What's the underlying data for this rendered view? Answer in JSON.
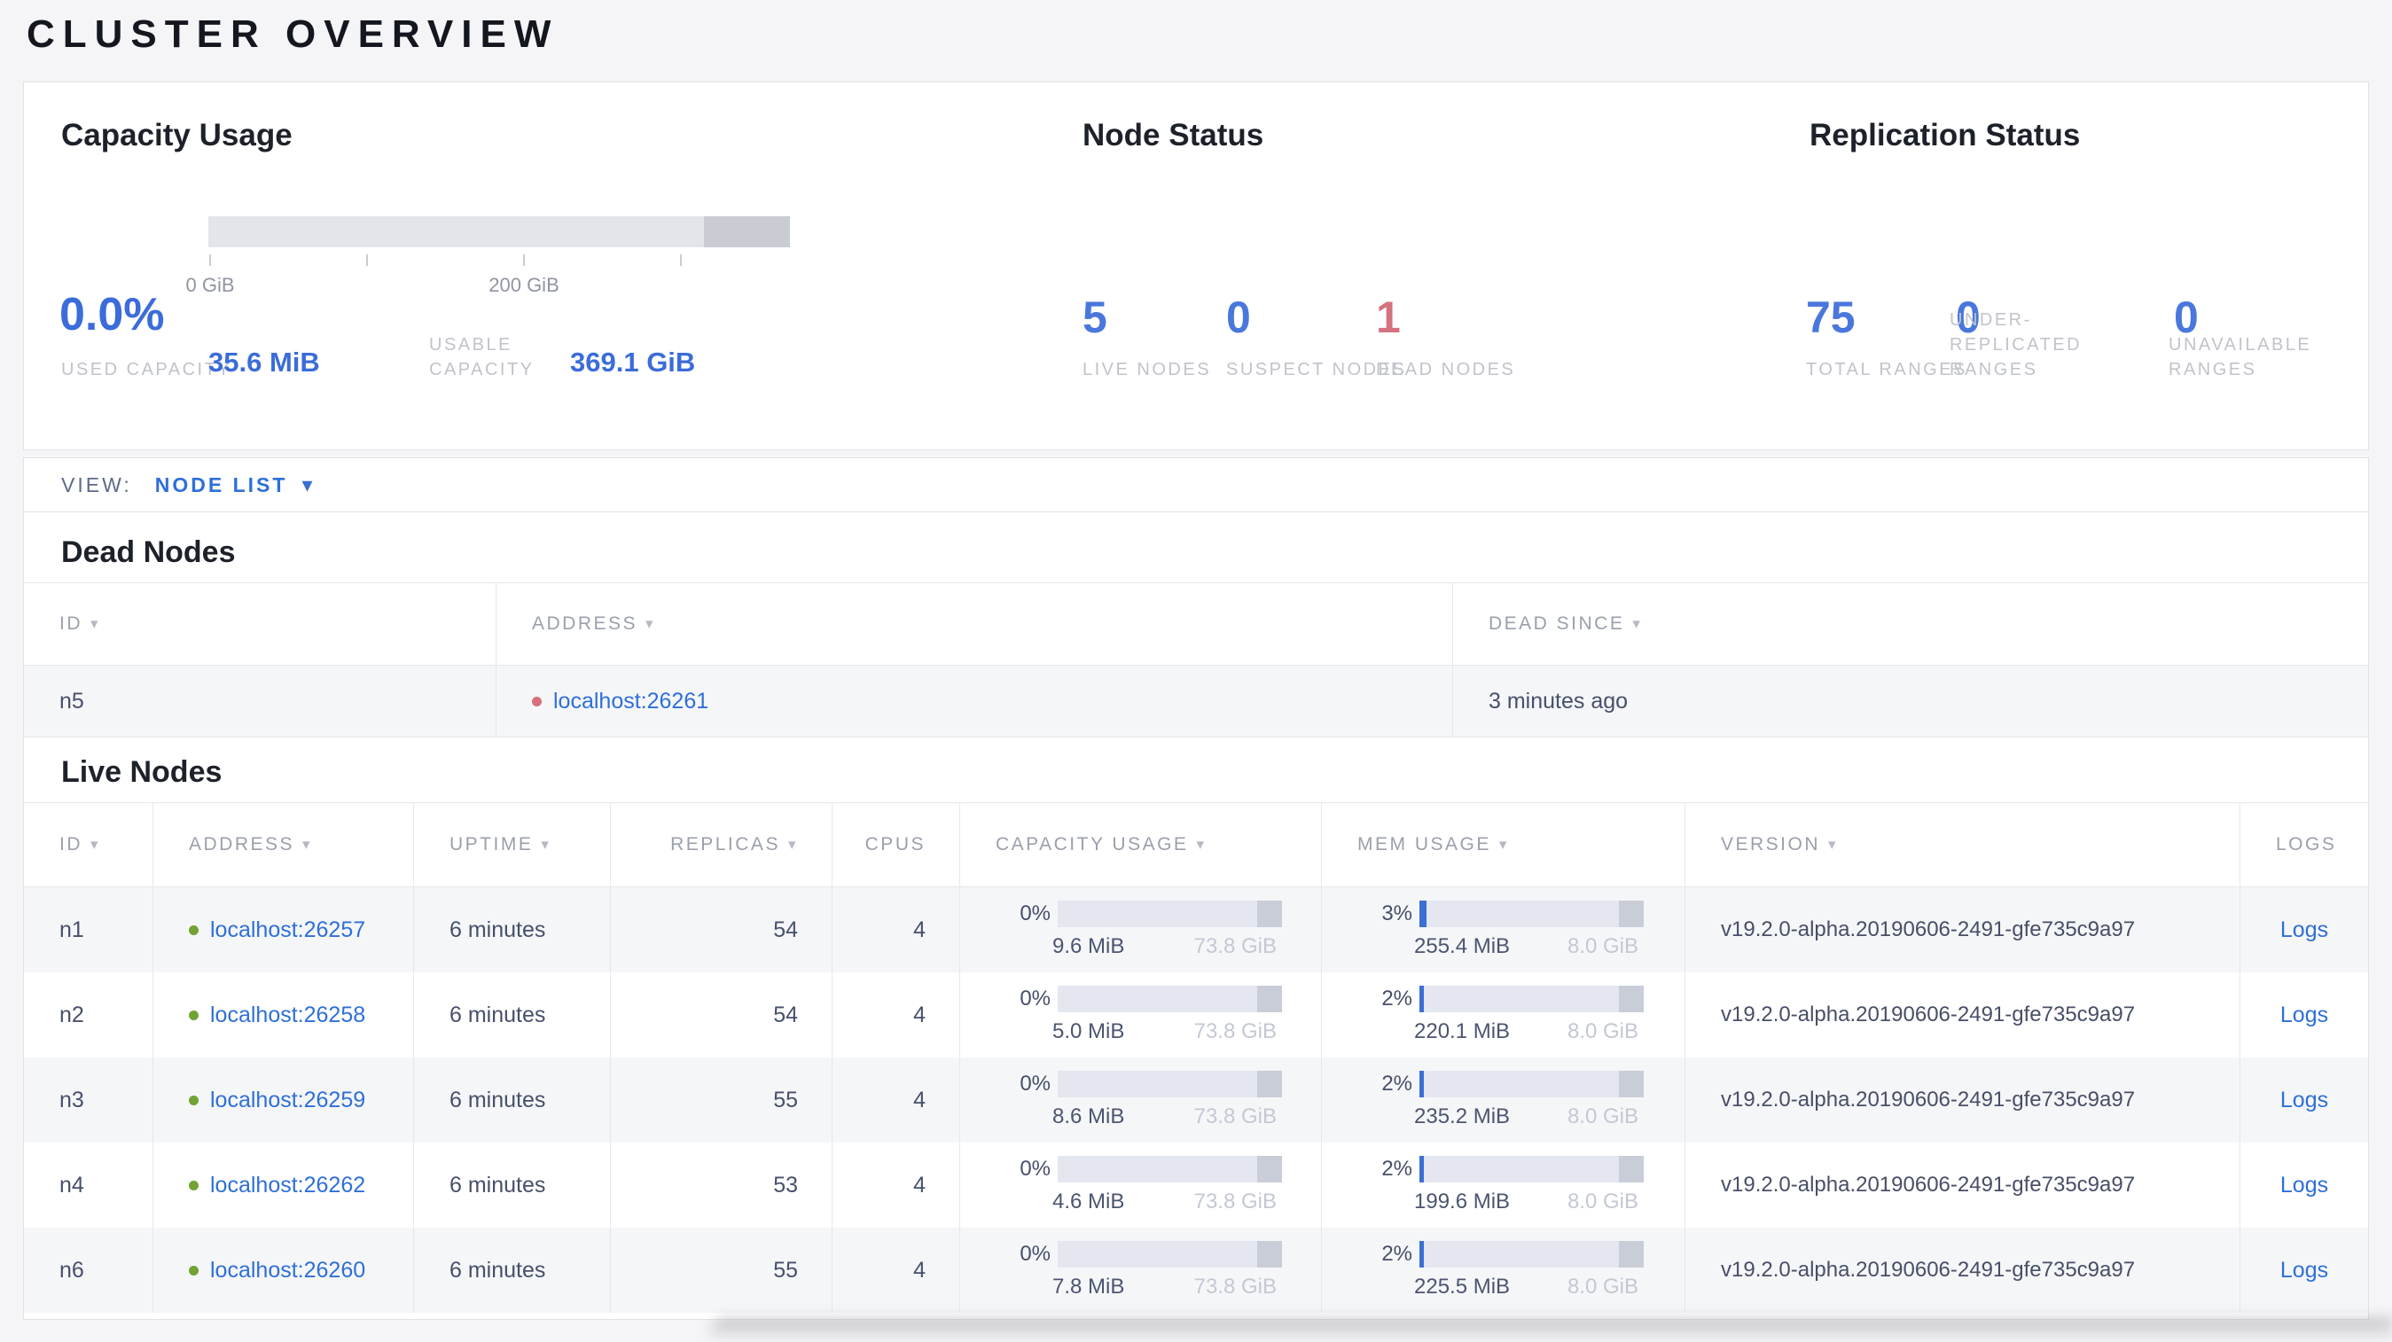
{
  "page": {
    "title": "CLUSTER OVERVIEW"
  },
  "icons": {
    "sort_arrow": "▾",
    "dropdown_arrow": "▾"
  },
  "colors": {
    "accent_blue": "#4a77dc",
    "link_blue": "#2e6fd8",
    "danger_red": "#d4737f",
    "live_green": "#71a233",
    "dead_red": "#d5707b"
  },
  "capacity_usage": {
    "title": "Capacity Usage",
    "percent": "0.0%",
    "axis_ticks": {
      "t0": "0 GiB",
      "t200": "200 GiB"
    },
    "used": {
      "label": "USED CAPACITY",
      "value": "35.6 MiB"
    },
    "usable": {
      "label": "USABLE CAPACITY",
      "value": "369.1 GiB"
    }
  },
  "node_status": {
    "title": "Node Status",
    "stats": [
      {
        "value": "5",
        "label": "LIVE NODES"
      },
      {
        "value": "0",
        "label": "SUSPECT NODES"
      },
      {
        "value": "1",
        "label": "DEAD NODES"
      }
    ]
  },
  "replication_status": {
    "title": "Replication Status",
    "stats": [
      {
        "value": "75",
        "label": "TOTAL RANGES"
      },
      {
        "value": "0",
        "label": "UNDER-REPLICATED RANGES"
      },
      {
        "value": "0",
        "label": "UNAVAILABLE RANGES"
      }
    ]
  },
  "view_bar": {
    "label": "VIEW:",
    "selected": "NODE LIST"
  },
  "dead_nodes": {
    "title": "Dead Nodes",
    "columns": {
      "id": "ID",
      "address": "ADDRESS",
      "dead_since": "DEAD SINCE"
    },
    "rows": [
      {
        "id": "n5",
        "address": "localhost:26261",
        "dead_since": "3 minutes ago"
      }
    ]
  },
  "live_nodes": {
    "title": "Live Nodes",
    "columns": {
      "id": "ID",
      "address": "ADDRESS",
      "uptime": "UPTIME",
      "replicas": "REPLICAS",
      "cpus": "CPUS",
      "capacity": "CAPACITY USAGE",
      "mem": "MEM USAGE",
      "version": "VERSION",
      "logs": "LOGS"
    },
    "rows": [
      {
        "id": "n1",
        "address": "localhost:26257",
        "uptime": "6 minutes",
        "replicas": "54",
        "cpus": "4",
        "capacity_percent": "0%",
        "capacity_used": "9.6 MiB",
        "capacity_total": "73.8 GiB",
        "mem_percent": "3%",
        "mem_used": "255.4 MiB",
        "mem_total": "8.0 GiB",
        "version": "v19.2.0-alpha.20190606-2491-gfe735c9a97",
        "logs_label": "Logs"
      },
      {
        "id": "n2",
        "address": "localhost:26258",
        "uptime": "6 minutes",
        "replicas": "54",
        "cpus": "4",
        "capacity_percent": "0%",
        "capacity_used": "5.0 MiB",
        "capacity_total": "73.8 GiB",
        "mem_percent": "2%",
        "mem_used": "220.1 MiB",
        "mem_total": "8.0 GiB",
        "version": "v19.2.0-alpha.20190606-2491-gfe735c9a97",
        "logs_label": "Logs"
      },
      {
        "id": "n3",
        "address": "localhost:26259",
        "uptime": "6 minutes",
        "replicas": "55",
        "cpus": "4",
        "capacity_percent": "0%",
        "capacity_used": "8.6 MiB",
        "capacity_total": "73.8 GiB",
        "mem_percent": "2%",
        "mem_used": "235.2 MiB",
        "mem_total": "8.0 GiB",
        "version": "v19.2.0-alpha.20190606-2491-gfe735c9a97",
        "logs_label": "Logs"
      },
      {
        "id": "n4",
        "address": "localhost:26262",
        "uptime": "6 minutes",
        "replicas": "53",
        "cpus": "4",
        "capacity_percent": "0%",
        "capacity_used": "4.6 MiB",
        "capacity_total": "73.8 GiB",
        "mem_percent": "2%",
        "mem_used": "199.6 MiB",
        "mem_total": "8.0 GiB",
        "version": "v19.2.0-alpha.20190606-2491-gfe735c9a97",
        "logs_label": "Logs"
      },
      {
        "id": "n6",
        "address": "localhost:26260",
        "uptime": "6 minutes",
        "replicas": "55",
        "cpus": "4",
        "capacity_percent": "0%",
        "capacity_used": "7.8 MiB",
        "capacity_total": "73.8 GiB",
        "mem_percent": "2%",
        "mem_used": "225.5 MiB",
        "mem_total": "8.0 GiB",
        "version": "v19.2.0-alpha.20190606-2491-gfe735c9a97",
        "logs_label": "Logs"
      }
    ]
  }
}
